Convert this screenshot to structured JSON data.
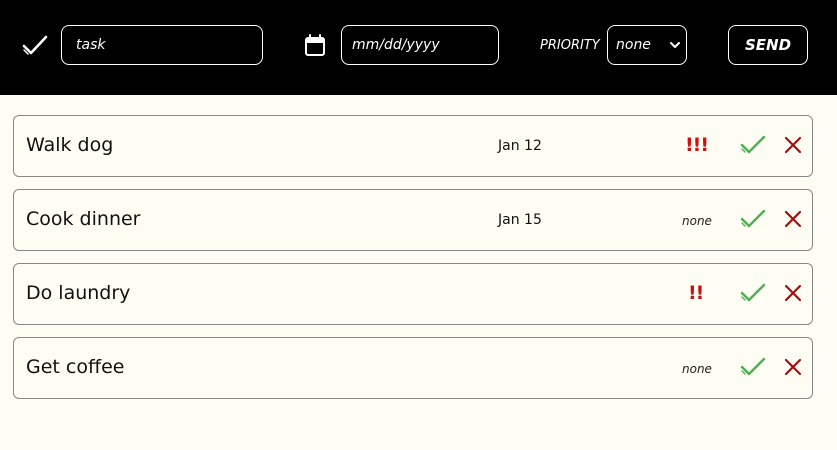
{
  "header": {
    "task_placeholder": "task",
    "date_placeholder": "mm/dd/yyyy",
    "priority_label": "PRIORITY",
    "priority_selected": "none",
    "send_label": "SEND",
    "icons": {
      "app": "check-icon",
      "date": "calendar-icon",
      "select": "chevron-down-icon"
    }
  },
  "todos": [
    {
      "title": "Walk dog",
      "date": "Jan 12",
      "priority": "!!!",
      "priority_is_none": false
    },
    {
      "title": "Cook dinner",
      "date": "Jan 15",
      "priority": "none",
      "priority_is_none": true
    },
    {
      "title": "Do laundry",
      "date": "",
      "priority": "!!",
      "priority_is_none": false
    },
    {
      "title": "Get coffee",
      "date": "",
      "priority": "none",
      "priority_is_none": true
    }
  ],
  "colors": {
    "header_bg": "#000000",
    "page_bg": "#fdfdf4",
    "priority_high": "#cc1111",
    "done_check": "#4caf50",
    "delete_x": "#a01010"
  }
}
